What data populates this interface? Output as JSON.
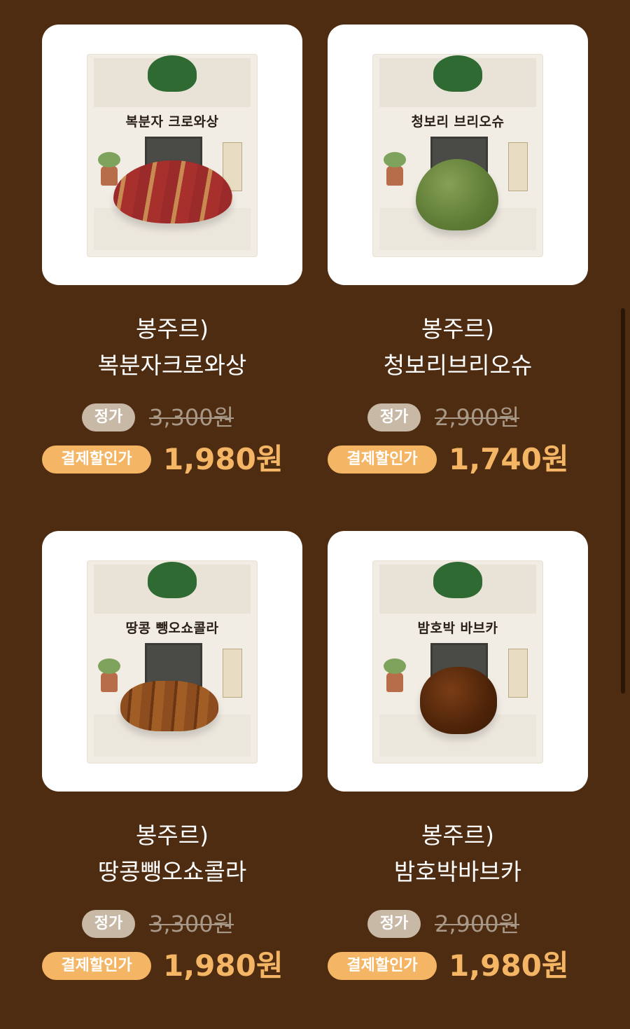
{
  "products": [
    {
      "package_name": "복분자 크로와상",
      "brand": "봉주르)",
      "name": "복분자크로와상",
      "regular_label": "정가",
      "regular_price": "3,300원",
      "sale_label": "결제할인가",
      "sale_price": "1,980원"
    },
    {
      "package_name": "청보리 브리오슈",
      "brand": "봉주르)",
      "name": "청보리브리오슈",
      "regular_label": "정가",
      "regular_price": "2,900원",
      "sale_label": "결제할인가",
      "sale_price": "1,740원"
    },
    {
      "package_name": "땅콩 뺑오쇼콜라",
      "brand": "봉주르)",
      "name": "땅콩뺑오쇼콜라",
      "regular_label": "정가",
      "regular_price": "3,300원",
      "sale_label": "결제할인가",
      "sale_price": "1,980원"
    },
    {
      "package_name": "밤호박 바브카",
      "brand": "봉주르)",
      "name": "밤호박바브카",
      "regular_label": "정가",
      "regular_price": "2,900원",
      "sale_label": "결제할인가",
      "sale_price": "1,980원"
    }
  ],
  "colors": {
    "background": "#4e2c11",
    "accent": "#f4b564",
    "regular_pill": "#c8b8a6",
    "strike_price": "#a89888"
  }
}
